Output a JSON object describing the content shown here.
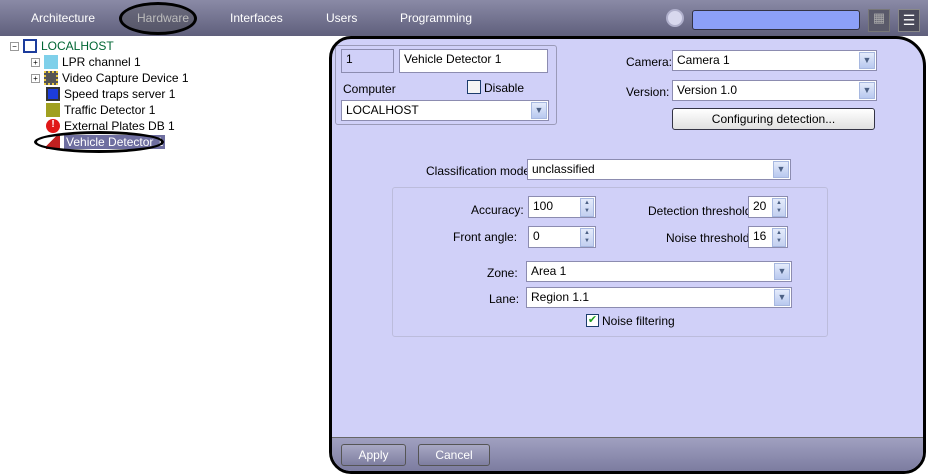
{
  "topbar": {
    "tabs": [
      "Architecture",
      "Hardware",
      "Interfaces",
      "Users",
      "Programming"
    ],
    "active_tab": "Hardware",
    "search_value": ""
  },
  "tree": {
    "root": "LOCALHOST",
    "items": [
      {
        "label": "LPR channel 1",
        "icon": "lpr-icon",
        "expandable": true
      },
      {
        "label": "Video Capture Device 1",
        "icon": "chip-icon",
        "expandable": true
      },
      {
        "label": "Speed traps server 1",
        "icon": "computer-icon",
        "expandable": false
      },
      {
        "label": "Traffic Detector 1",
        "icon": "traffic-icon",
        "expandable": false
      },
      {
        "label": "External Plates DB 1",
        "icon": "alert-icon",
        "expandable": false
      },
      {
        "label": "Vehicle Detector 1",
        "icon": "vehicle-detector-icon",
        "expandable": false,
        "selected": true
      }
    ]
  },
  "panel": {
    "id": "1",
    "name": "Vehicle Detector 1",
    "computer_label": "Computer",
    "disable_label": "Disable",
    "disable_checked": false,
    "computer_value": "LOCALHOST",
    "camera_label": "Camera:",
    "camera_value": "Camera 1",
    "version_label": "Version:",
    "version_value": "Version 1.0",
    "configure_button": "Configuring detection...",
    "classification_label": "Classification mode:",
    "classification_value": "unclassified",
    "accuracy_label": "Accuracy:",
    "accuracy_value": "100",
    "front_angle_label": "Front angle:",
    "front_angle_value": "0",
    "detection_threshold_label": "Detection threshold:",
    "detection_threshold_value": "20",
    "noise_threshold_label": "Noise threshold:",
    "noise_threshold_value": "16",
    "zone_label": "Zone:",
    "zone_value": "Area 1",
    "lane_label": "Lane:",
    "lane_value": "Region 1.1",
    "noise_filtering_label": "Noise filtering",
    "noise_filtering_checked": true,
    "apply": "Apply",
    "cancel": "Cancel"
  },
  "colors": {
    "panel_bg": "#d0d0f8",
    "selection": "#6e6ea0",
    "tree_root": "#006633"
  }
}
